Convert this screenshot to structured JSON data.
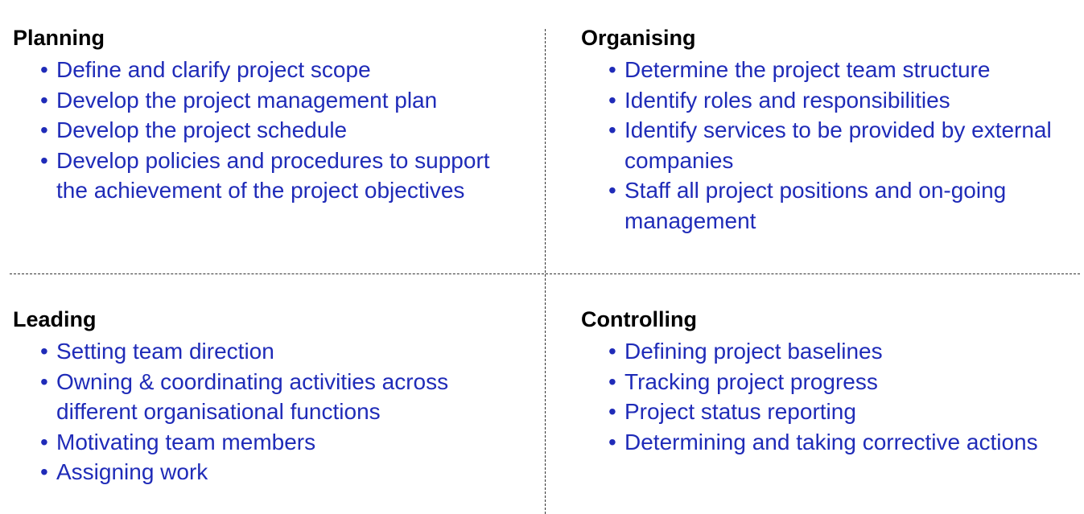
{
  "quadrants": {
    "planning": {
      "title": "Planning",
      "items": [
        "Define and clarify project scope",
        "Develop the project management plan",
        "Develop the project schedule",
        "Develop policies and procedures to support the achievement of the project objectives"
      ]
    },
    "organising": {
      "title": "Organising",
      "items": [
        "Determine the project team structure",
        "Identify roles and responsibilities",
        "Identify services to be provided by external companies",
        "Staff all project positions and on-going management"
      ]
    },
    "leading": {
      "title": "Leading",
      "items": [
        "Setting team direction",
        "Owning & coordinating activities across different organisational functions",
        "Motivating team members",
        "Assigning work"
      ]
    },
    "controlling": {
      "title": "Controlling",
      "items": [
        "Defining project baselines",
        "Tracking project progress",
        "Project status reporting",
        "Determining and taking corrective actions"
      ]
    }
  },
  "colors": {
    "title": "#000000",
    "item_text": "#1f2bb8",
    "divider": "#333333"
  },
  "bullet_glyph": "•"
}
